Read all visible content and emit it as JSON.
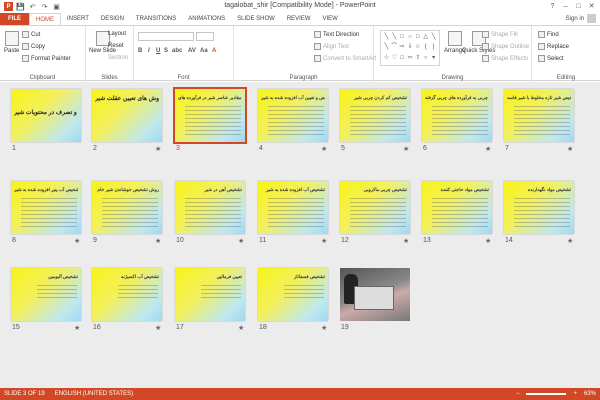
{
  "window": {
    "title": "tagalobat_shir [Compatibility Mode] - PowerPoint",
    "controls": [
      "?",
      "–",
      "□",
      "✕"
    ]
  },
  "qat": {
    "app_icon": "P",
    "save": "💾",
    "undo": "↶",
    "redo": "↷",
    "start": "▣"
  },
  "tabs": [
    "FILE",
    "HOME",
    "INSERT",
    "DESIGN",
    "TRANSITIONS",
    "ANIMATIONS",
    "SLIDE SHOW",
    "REVIEW",
    "VIEW"
  ],
  "active_tab": "HOME",
  "signin": "Sign in",
  "ribbon": {
    "clipboard": {
      "label": "Clipboard",
      "paste": "Paste",
      "cut": "Cut",
      "copy": "Copy",
      "format_painter": "Format Painter"
    },
    "slides": {
      "label": "Slides",
      "new_slide": "New Slide",
      "layout": "Layout",
      "reset": "Reset",
      "section": "Section"
    },
    "font": {
      "label": "Font",
      "bold": "B",
      "italic": "I",
      "underline": "U",
      "strike": "S",
      "shadow": "abc",
      "aa": "AV",
      "case": "Aa",
      "color": "A"
    },
    "paragraph": {
      "label": "Paragraph",
      "text_direction": "Text Direction",
      "align_text": "Align Text",
      "convert": "Convert to SmartArt"
    },
    "drawing": {
      "label": "Drawing",
      "arrange": "Arrange",
      "quick_styles": "Quick Styles",
      "shape_fill": "Shape Fill",
      "shape_outline": "Shape Outline",
      "shape_effects": "Shape Effects"
    },
    "editing": {
      "label": "Editing",
      "find": "Find",
      "replace": "Replace",
      "select": "Select"
    }
  },
  "slides": [
    {
      "n": "1",
      "title": "دخل و تصرف در محتويات شير",
      "star": false
    },
    {
      "n": "2",
      "title": "روش های تعيين عقلت شير",
      "star": true
    },
    {
      "n": "3",
      "title": "تقلبات مربوط به مقادير عناصر شير در فرآورده های",
      "star": false,
      "selected": true
    },
    {
      "n": "4",
      "title": "تشخيص و تعيين آب افزوده شده به شير",
      "star": true
    },
    {
      "n": "5",
      "title": "تشخيص کم کردن چربی شير",
      "star": true
    },
    {
      "n": "6",
      "title": "اضافه کردن چربی به فرآورده های چربی گرفته",
      "star": true
    },
    {
      "n": "7",
      "title": "تشخيص شير تازه مخلوط با شير فاسد",
      "star": true
    },
    {
      "n": "8",
      "title": "تشخيص آب پنير افزوده شده به شير",
      "star": true
    },
    {
      "n": "9",
      "title": "روش تشخيص جوشاندن شير خام",
      "star": true
    },
    {
      "n": "10",
      "title": "تشخيص آهن در شير",
      "star": true
    },
    {
      "n": "11",
      "title": "تشخيص آب افزوده شده به شير",
      "star": true
    },
    {
      "n": "12",
      "title": "تشخيص چربی ماکروبی",
      "star": true
    },
    {
      "n": "13",
      "title": "تشخيص مواد حاجتی کننده",
      "star": true
    },
    {
      "n": "14",
      "title": "تشخيص مواد نگهدارنده",
      "star": true
    },
    {
      "n": "15",
      "title": "تشخيص آلبومين",
      "star": true
    },
    {
      "n": "16",
      "title": "تشخيص آب اکسيژنه",
      "star": true
    },
    {
      "n": "17",
      "title": "تعيين فرمالين",
      "star": true
    },
    {
      "n": "18",
      "title": "تشخيص فسفاتاز",
      "star": true
    },
    {
      "n": "19",
      "title": "",
      "star": false,
      "photo": true
    }
  ],
  "status": {
    "slide": "SLIDE 3 OF 19",
    "language": "ENGLISH (UNITED STATES)",
    "zoom": "63%"
  },
  "colors": {
    "accent": "#d24726",
    "slide_top": "#f8f318",
    "slide_bottom": "#9fd8f2"
  }
}
